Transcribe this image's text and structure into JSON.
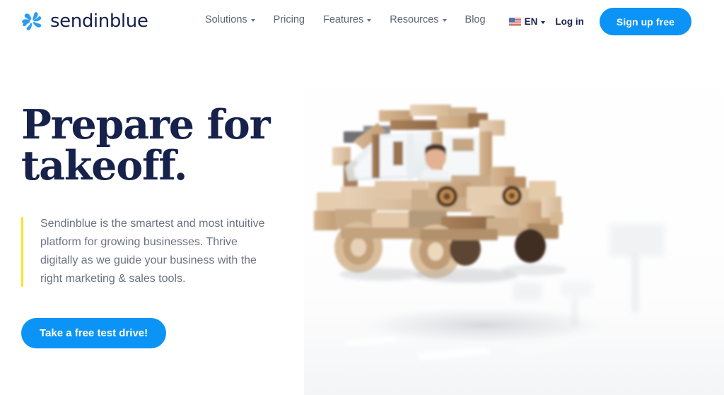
{
  "brand": {
    "name": "sendinblue",
    "logo_icon": "pinwheel-logo-icon",
    "logo_color": "#2c9cf0",
    "wordmark_color": "#16224b"
  },
  "nav": {
    "items": [
      {
        "label": "Solutions",
        "has_dropdown": true
      },
      {
        "label": "Pricing",
        "has_dropdown": false
      },
      {
        "label": "Features",
        "has_dropdown": true
      },
      {
        "label": "Resources",
        "has_dropdown": true
      },
      {
        "label": "Blog",
        "has_dropdown": false
      }
    ]
  },
  "header_right": {
    "language": {
      "code": "EN",
      "flag_icon": "us-flag-icon",
      "has_dropdown": true
    },
    "login_label": "Log in",
    "signup_label": "Sign up free",
    "signup_color": "#0b94f5"
  },
  "hero": {
    "headline_line1": "Prepare for",
    "headline_line2": "takeoff.",
    "headline_color": "#16224b",
    "accent_bar_color": "#ffe02b",
    "blurb": "Sendinblue is the smartest and most intuitive platform for growing businesses. Thrive digitally as we guide your business with the right marketing & sales tools.",
    "cta_label": "Take a free test drive!",
    "cta_color": "#0b94f5",
    "image_alt": "wooden-toy-block-car-with-driver-on-road"
  }
}
